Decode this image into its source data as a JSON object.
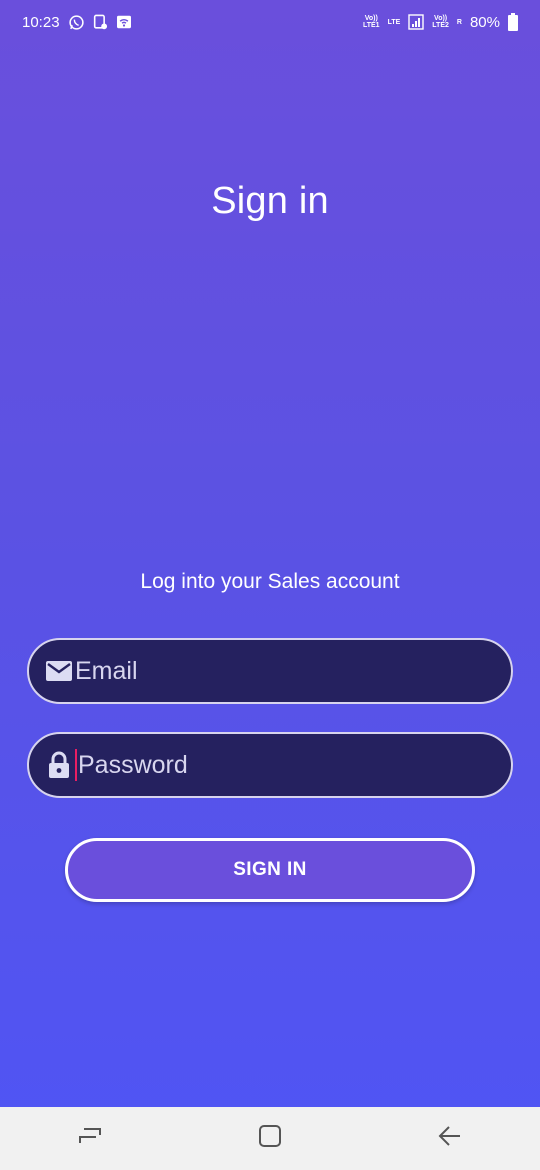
{
  "status_bar": {
    "time": "10:23",
    "battery": "80%",
    "sim1_label_top": "Vo))",
    "sim1_label_bottom": "LTE1",
    "lte_label": "LTE",
    "sim2_label_top": "Vo))",
    "sim2_label_bottom": "LTE2",
    "roaming": "R",
    "icons": [
      "whatsapp-icon",
      "screenshot-icon",
      "wifi-icon",
      "signal-icon",
      "battery-icon"
    ]
  },
  "page": {
    "title": "Sign in",
    "subtitle": "Log into your Sales account"
  },
  "form": {
    "email_placeholder": "Email",
    "password_placeholder": "Password",
    "submit_label": "SIGN IN"
  },
  "navbar": {
    "icons": [
      "recents-icon",
      "home-icon",
      "back-icon"
    ]
  },
  "colors": {
    "background_top": "#6a4fdc",
    "background_bottom": "#4f55f5",
    "field_fill": "#25215f",
    "button_fill": "#6a4fdc",
    "caret": "#e91e63",
    "navbar": "#f1f1f1"
  }
}
